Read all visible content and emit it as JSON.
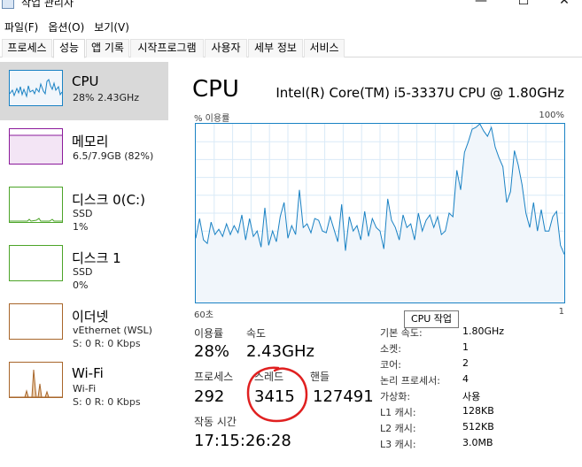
{
  "window": {
    "title": "작업 관리자",
    "minimize_glyph": "—",
    "maximize_glyph": "☐",
    "close_glyph": "✕"
  },
  "menu": [
    {
      "label": "파일(F)"
    },
    {
      "label": "옵션(O)"
    },
    {
      "label": "보기(V)"
    }
  ],
  "tabs": [
    {
      "label": "프로세스",
      "active": false
    },
    {
      "label": "성능",
      "active": true
    },
    {
      "label": "앱 기록",
      "active": false
    },
    {
      "label": "시작프로그램",
      "active": false
    },
    {
      "label": "사용자",
      "active": false
    },
    {
      "label": "세부 정보",
      "active": false
    },
    {
      "label": "서비스",
      "active": false
    }
  ],
  "sidebar": {
    "items": [
      {
        "name": "CPU",
        "line1": "28% 2.43GHz",
        "line2": "",
        "color": "#1a82c4"
      },
      {
        "name": "메모리",
        "line1": "6.5/7.9GB (82%)",
        "line2": "",
        "color": "#8b1a9b"
      },
      {
        "name": "디스크 0(C:)",
        "line1": "SSD",
        "line2": "1%",
        "color": "#4ca428"
      },
      {
        "name": "디스크 1",
        "line1": "SSD",
        "line2": "0%",
        "color": "#4ca428"
      },
      {
        "name": "이더넷",
        "line1": "vEthernet (WSL)",
        "line2": "S: 0 R: 0 Kbps",
        "color": "#a8662a"
      },
      {
        "name": "Wi-Fi",
        "line1": "Wi-Fi",
        "line2": "S: 0 R: 0 Kbps",
        "color": "#a8662a"
      }
    ]
  },
  "main": {
    "title": "CPU",
    "model": "Intel(R) Core(TM) i5-3337U CPU @ 1.80GHz",
    "graph_label_top_left": "% 이용률",
    "graph_label_top_right": "100%",
    "graph_label_bottom_left": "60초",
    "graph_label_bottom_right": "1",
    "tooltip": "CPU 작업",
    "stats": {
      "utilization_label": "이용률",
      "utilization_value": "28%",
      "speed_label": "속도",
      "speed_value": "2.43GHz",
      "processes_label": "프로세스",
      "processes_value": "292",
      "threads_label": "스레드",
      "threads_value": "3415",
      "handles_label": "핸들",
      "handles_value": "127491",
      "uptime_label": "작동 시간",
      "uptime_value": "17:15:26:28"
    },
    "specs": [
      {
        "key": "기본 속도:",
        "value": "1.80GHz"
      },
      {
        "key": "소켓:",
        "value": "1"
      },
      {
        "key": "코어:",
        "value": "2"
      },
      {
        "key": "논리 프로세서:",
        "value": "4"
      },
      {
        "key": "가상화:",
        "value": "사용"
      },
      {
        "key": "L1 캐시:",
        "value": "128KB"
      },
      {
        "key": "L2 캐시:",
        "value": "512KB"
      },
      {
        "key": "L3 캐시:",
        "value": "3.0MB"
      }
    ]
  },
  "chart_data": {
    "type": "area",
    "ylim": [
      0,
      100
    ],
    "values": [
      36,
      47,
      35,
      33,
      45,
      38,
      41,
      37,
      44,
      38,
      43,
      39,
      49,
      35,
      47,
      37,
      40,
      31,
      53,
      32,
      40,
      34,
      48,
      56,
      36,
      43,
      38,
      63,
      42,
      44,
      39,
      47,
      46,
      40,
      39,
      48,
      41,
      34,
      55,
      29,
      48,
      40,
      43,
      35,
      51,
      37,
      47,
      42,
      40,
      30,
      58,
      46,
      42,
      35,
      49,
      42,
      44,
      35,
      50,
      40,
      46,
      49,
      42,
      48,
      38,
      40,
      50,
      48,
      74,
      63,
      84,
      90,
      97,
      98,
      100,
      96,
      93,
      98,
      87,
      81,
      76,
      56,
      62,
      85,
      77,
      66,
      50,
      42,
      56,
      40,
      52,
      40,
      40,
      48,
      51,
      32,
      27
    ]
  }
}
